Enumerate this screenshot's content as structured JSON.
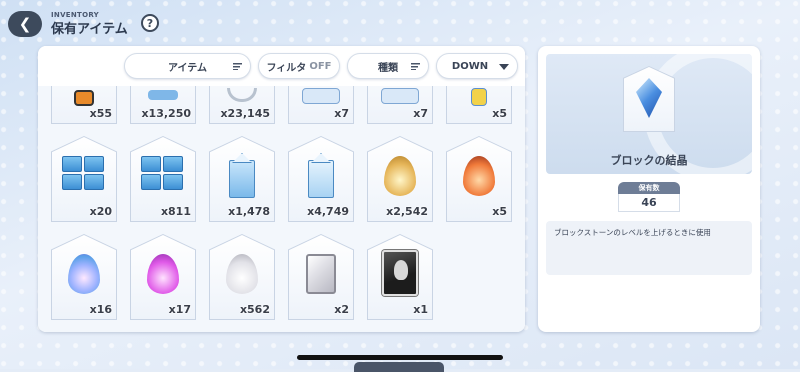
{
  "header": {
    "subtitle": "INVENTORY",
    "title": "保有アイテム",
    "help": "?"
  },
  "filters": {
    "category": "アイテム",
    "filter_label": "フィルタ",
    "filter_state": "OFF",
    "sort_type": "種類",
    "order": "DOWN"
  },
  "items_row0": [
    {
      "count": "x55"
    },
    {
      "count": "x13,250"
    },
    {
      "count": "x23,145"
    },
    {
      "count": "x7"
    },
    {
      "count": "x7"
    },
    {
      "count": "x5"
    }
  ],
  "items_row1": [
    {
      "count": "x20",
      "icon": "box-stack-icon"
    },
    {
      "count": "x811",
      "icon": "box-stack-icon"
    },
    {
      "count": "x1,478",
      "icon": "milk-carton-icon"
    },
    {
      "count": "x4,749",
      "icon": "juice-carton-icon"
    },
    {
      "count": "x2,542",
      "icon": "gold-drop-icon"
    },
    {
      "count": "x5",
      "icon": "red-drop-icon"
    }
  ],
  "items_row2": [
    {
      "count": "x16",
      "icon": "blue-drop-icon"
    },
    {
      "count": "x17",
      "icon": "purple-drop-icon"
    },
    {
      "count": "x562",
      "icon": "white-drop-icon"
    },
    {
      "count": "x2",
      "icon": "white-gem-icon"
    },
    {
      "count": "x1",
      "icon": "card-icon"
    }
  ],
  "detail": {
    "name": "ブロックの結晶",
    "qty_label": "保有数",
    "qty_value": "46",
    "description": "ブロックストーンのレベルを上げるときに使用"
  }
}
